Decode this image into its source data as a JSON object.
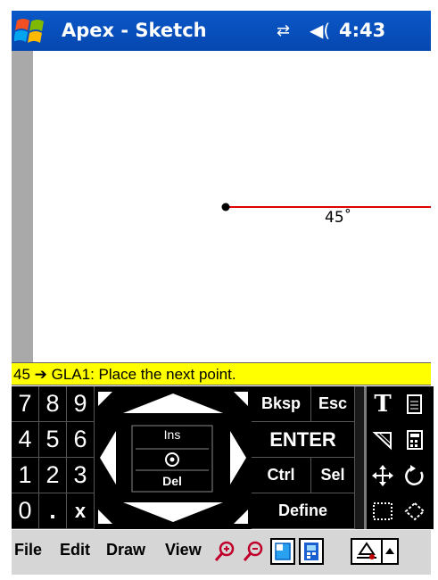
{
  "window": {
    "title": "Apex - Sketch",
    "time": "4:43",
    "icons": [
      "windows-start-icon",
      "connectivity-icon",
      "volume-icon"
    ]
  },
  "sketch": {
    "angle_label": "45˚",
    "line_color": "#e00000"
  },
  "prompt": {
    "text": "45 ➔ GLA1: Place the next point.",
    "background": "#ffff00"
  },
  "keypad": {
    "numbers": [
      "7",
      "8",
      "9",
      "4",
      "5",
      "6",
      "1",
      "2",
      "3",
      "0",
      ".",
      "x"
    ],
    "center": {
      "ins": "Ins",
      "del": "Del"
    },
    "keys": {
      "bksp": "Bksp",
      "esc": "Esc",
      "enter": "ENTER",
      "ctrl": "Ctrl",
      "sel": "Sel",
      "define": "Define"
    },
    "tool_glyphs": {
      "text": "T",
      "page": "🖹"
    }
  },
  "menubar": {
    "file": "File",
    "edit": "Edit",
    "draw": "Draw",
    "view": "View"
  }
}
